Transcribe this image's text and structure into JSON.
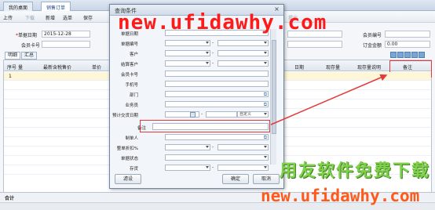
{
  "tabs": {
    "home": "我的桌面",
    "sales_order": "销售订单"
  },
  "toolbar": {
    "add": "上传",
    "down": "下载",
    "new": "新增",
    "select": "选单",
    "save": "保存",
    "tail": "提出"
  },
  "header": {
    "doc_date_label": "单据日期",
    "doc_date_value": "2015-12-28",
    "member_card_label": "会员卡号",
    "member_no_label": "会员编号",
    "order_amount_label": "订金金额",
    "order_amount_value": "0.00"
  },
  "subtabs": {
    "detail": "明细",
    "summary": "汇总"
  },
  "grid": {
    "headers": [
      "序号",
      "量",
      "最新含税售价",
      "单价",
      "日期",
      "现存量",
      "现存量说明",
      "备注"
    ],
    "rows": [
      "1",
      "",
      "",
      "",
      "",
      "",
      "",
      "",
      "",
      "",
      ""
    ],
    "footer_label": "合计"
  },
  "dialog": {
    "title": "查询条件",
    "fields": [
      {
        "label": "单据日期"
      },
      {
        "label": "单据编号"
      },
      {
        "label": "客户"
      },
      {
        "label": "结算客户"
      },
      {
        "label": "会员卡号"
      },
      {
        "label": "手机号"
      },
      {
        "label": "部门"
      },
      {
        "label": "业务员"
      },
      {
        "label": "预计交货日期"
      },
      {
        "label": "备注"
      },
      {
        "label": "制单人"
      },
      {
        "label": "整单折扣%"
      },
      {
        "label": "单据状态"
      },
      {
        "label": "存货"
      }
    ],
    "custom_label": "自定义",
    "buttons": {
      "filter": "滤设",
      "ok": "确定",
      "cancel": "取消"
    }
  },
  "watermark": {
    "top_url": "new.ufidawhy.com",
    "cn_text": "用友软件免费下载",
    "bottom_url": "new.ufidawhy.com"
  },
  "colors": {
    "highlight": "#e23b3b",
    "watermark_red": "#ff1a1a",
    "watermark_green": "#7fd04a"
  }
}
